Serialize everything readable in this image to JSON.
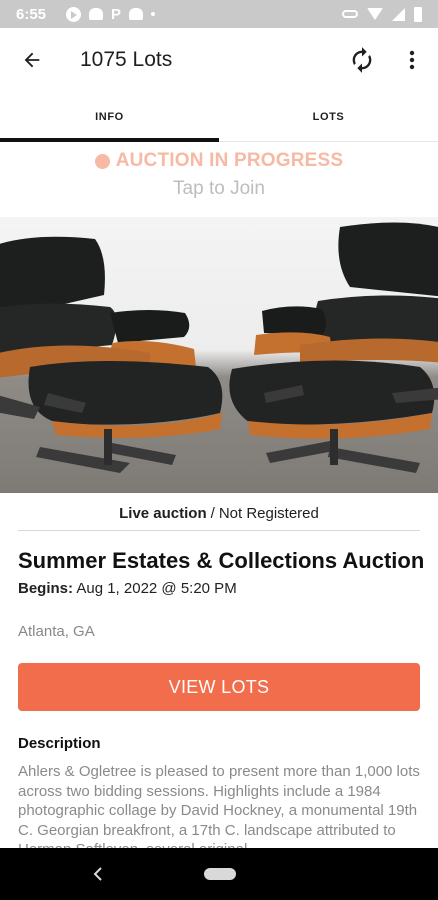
{
  "status_bar": {
    "time": "6:55",
    "icons_left": [
      "play-icon",
      "android-icon",
      "p-icon",
      "android-icon",
      "dot-icon"
    ],
    "icons_right": [
      "key-icon",
      "wifi-icon",
      "signal-icon",
      "battery-icon"
    ]
  },
  "app_bar": {
    "title": "1075 Lots",
    "back_icon": "arrow-left-icon",
    "refresh_icon": "refresh-icon",
    "more_icon": "more-vert-icon"
  },
  "tabs": [
    {
      "label": "INFO",
      "active": true
    },
    {
      "label": "LOTS",
      "active": false
    }
  ],
  "live": {
    "status": "AUCTION IN PROGRESS",
    "action": "Tap to Join",
    "color": "#f7b9a3"
  },
  "hero_image": {
    "subject": "two black leather lounge chairs with ottomans"
  },
  "auction": {
    "type": "Live auction",
    "separator": "/",
    "registration": "Not Registered",
    "title": "Summer Estates & Collections Auction",
    "begins_label": "Begins:",
    "begins_value": "Aug 1, 2022 @ 5:20 PM",
    "location": "Atlanta, GA"
  },
  "cta": {
    "label": "VIEW LOTS",
    "color": "#f26d4b"
  },
  "description": {
    "heading": "Description",
    "body": "Ahlers & Ogletree is pleased to present more than 1,000 lots across two bidding sessions. Highlights include a 1984 photographic collage by David Hockney, a monumental 19th C. Georgian breakfront, a 17th C. landscape attributed to Herman Saftleven, several original"
  },
  "nav_bar": {
    "back_icon": "nav-back-icon",
    "home_icon": "nav-home-pill-icon"
  }
}
